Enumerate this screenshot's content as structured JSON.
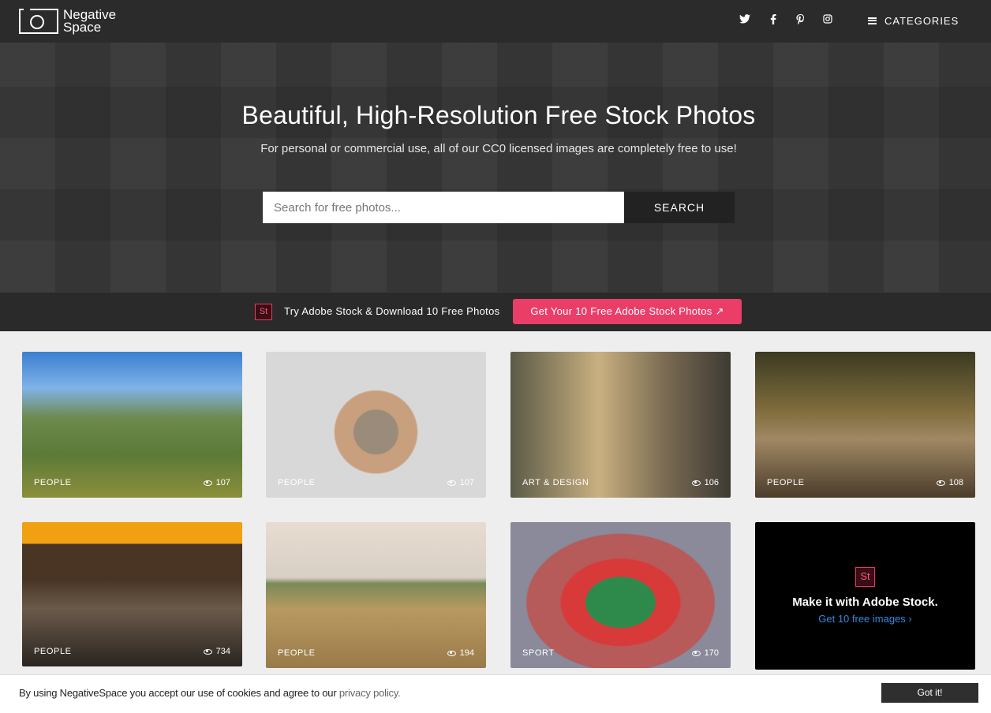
{
  "header": {
    "logo_line1": "Negative",
    "logo_line2": "Space",
    "social_icons": [
      "twitter-icon",
      "facebook-icon",
      "pinterest-icon",
      "instagram-icon"
    ],
    "categories_label": "CATEGORIES"
  },
  "hero": {
    "title": "Beautiful, High-Resolution Free Stock Photos",
    "subtitle": "For personal or commercial use, all of our CC0 licensed images are completely free to use!",
    "search_placeholder": "Search for free photos...",
    "search_button": "SEARCH"
  },
  "promo": {
    "logo_text": "St",
    "text": "Try Adobe Stock & Download 10 Free Photos",
    "button": "Get Your 10 Free Adobe Stock Photos ↗"
  },
  "cards": [
    {
      "category": "PEOPLE",
      "views": "107"
    },
    {
      "category": "PEOPLE",
      "views": "107"
    },
    {
      "category": "ART & DESIGN",
      "views": "106"
    },
    {
      "category": "PEOPLE",
      "views": "108"
    },
    {
      "category": "PEOPLE",
      "views": "734"
    },
    {
      "category": "PEOPLE",
      "views": "194"
    },
    {
      "category": "SPORT",
      "views": "170"
    }
  ],
  "ad": {
    "logo_text": "St",
    "title": "Make it with Adobe Stock.",
    "link": "Get 10 free images ›"
  },
  "cookie": {
    "text": "By using NegativeSpace you accept our use of cookies and agree to our",
    "link": "privacy policy.",
    "button": "Got it!"
  },
  "colors": {
    "accent": "#ea3e69",
    "header_bg": "#2b2b2b",
    "page_bg": "#eeeeee"
  }
}
